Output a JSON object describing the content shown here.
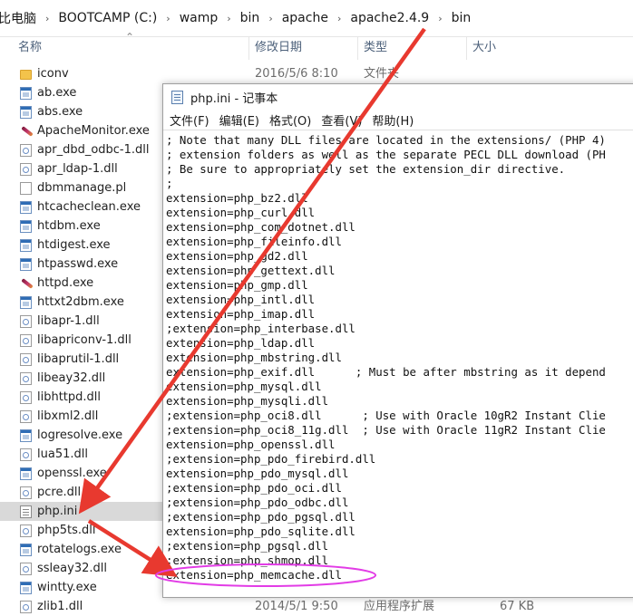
{
  "breadcrumb": [
    "比电脑",
    "BOOTCAMP (C:)",
    "wamp",
    "bin",
    "apache",
    "apache2.4.9",
    "bin"
  ],
  "columns": {
    "name": "名称",
    "date": "修改日期",
    "type": "类型",
    "size": "大小"
  },
  "files": [
    {
      "name": "iconv",
      "icon": "folder-icon",
      "date": "2016/5/6 8:10",
      "type": "文件夹",
      "size": ""
    },
    {
      "name": "ab.exe",
      "icon": "exe-icon"
    },
    {
      "name": "abs.exe",
      "icon": "exe-icon"
    },
    {
      "name": "ApacheMonitor.exe",
      "icon": "feather-icon"
    },
    {
      "name": "apr_dbd_odbc-1.dll",
      "icon": "dll-icon"
    },
    {
      "name": "apr_ldap-1.dll",
      "icon": "dll-icon"
    },
    {
      "name": "dbmmanage.pl",
      "icon": "document-icon"
    },
    {
      "name": "htcacheclean.exe",
      "icon": "exe-icon"
    },
    {
      "name": "htdbm.exe",
      "icon": "exe-icon"
    },
    {
      "name": "htdigest.exe",
      "icon": "exe-icon"
    },
    {
      "name": "htpasswd.exe",
      "icon": "exe-icon"
    },
    {
      "name": "httpd.exe",
      "icon": "feather-icon"
    },
    {
      "name": "httxt2dbm.exe",
      "icon": "exe-icon"
    },
    {
      "name": "libapr-1.dll",
      "icon": "dll-icon"
    },
    {
      "name": "libapriconv-1.dll",
      "icon": "dll-icon"
    },
    {
      "name": "libaprutil-1.dll",
      "icon": "dll-icon"
    },
    {
      "name": "libeay32.dll",
      "icon": "dll-icon"
    },
    {
      "name": "libhttpd.dll",
      "icon": "dll-icon"
    },
    {
      "name": "libxml2.dll",
      "icon": "dll-icon"
    },
    {
      "name": "logresolve.exe",
      "icon": "exe-icon"
    },
    {
      "name": "lua51.dll",
      "icon": "dll-icon"
    },
    {
      "name": "openssl.exe",
      "icon": "exe-icon"
    },
    {
      "name": "pcre.dll",
      "icon": "dll-icon"
    },
    {
      "name": "php.ini",
      "icon": "ini-file-icon",
      "selected": true
    },
    {
      "name": "php5ts.dll",
      "icon": "dll-icon"
    },
    {
      "name": "rotatelogs.exe",
      "icon": "exe-icon"
    },
    {
      "name": "ssleay32.dll",
      "icon": "dll-icon"
    },
    {
      "name": "wintty.exe",
      "icon": "exe-icon"
    },
    {
      "name": "zlib1.dll",
      "icon": "dll-icon",
      "date": "2014/5/1 9:50",
      "type": "应用程序扩展",
      "size": "67 KB"
    }
  ],
  "notepad": {
    "title": "php.ini - 记事本",
    "menu": [
      "文件(F)",
      "编辑(E)",
      "格式(O)",
      "查看(V)",
      "帮助(H)"
    ],
    "lines": [
      "; Note that many DLL files are located in the extensions/ (PHP 4)",
      "; extension folders as well as the separate PECL DLL download (PH",
      "; Be sure to appropriately set the extension_dir directive.",
      ";",
      "extension=php_bz2.dll",
      "extension=php_curl.dll",
      "extension=php_com_dotnet.dll",
      "extension=php_fileinfo.dll",
      "extension=php_gd2.dll",
      "extension=php_gettext.dll",
      "extension=php_gmp.dll",
      "extension=php_intl.dll",
      "extension=php_imap.dll",
      ";extension=php_interbase.dll",
      "extension=php_ldap.dll",
      "extension=php_mbstring.dll",
      "extension=php_exif.dll      ; Must be after mbstring as it depend",
      "extension=php_mysql.dll",
      "extension=php_mysqli.dll",
      ";extension=php_oci8.dll      ; Use with Oracle 10gR2 Instant Clie",
      ";extension=php_oci8_11g.dll  ; Use with Oracle 11gR2 Instant Clie",
      "extension=php_openssl.dll",
      ";extension=php_pdo_firebird.dll",
      "extension=php_pdo_mysql.dll",
      ";extension=php_pdo_oci.dll",
      ";extension=php_pdo_odbc.dll",
      ";extension=php_pdo_pgsql.dll",
      "extension=php_pdo_sqlite.dll",
      ";extension=php_pgsql.dll",
      ";extension=php_shmop.dll",
      "extension=php_memcache.dll"
    ]
  },
  "colors": {
    "arrow": "#e8392f",
    "highlight_ellipse": "#e23ce6",
    "selected_row": "#d9d9d9"
  }
}
